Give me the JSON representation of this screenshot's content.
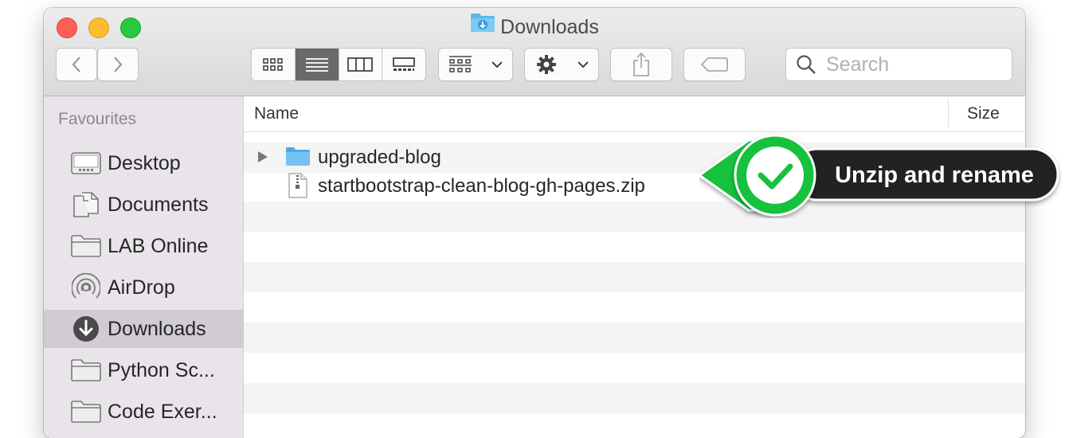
{
  "window": {
    "title": "Downloads"
  },
  "toolbar": {
    "search_placeholder": "Search"
  },
  "sidebar": {
    "heading": "Favourites",
    "items": [
      {
        "label": "Desktop",
        "icon": "desktop-icon"
      },
      {
        "label": "Documents",
        "icon": "documents-icon"
      },
      {
        "label": "LAB Online",
        "icon": "folder-icon"
      },
      {
        "label": "AirDrop",
        "icon": "airdrop-icon"
      },
      {
        "label": "Downloads",
        "icon": "downloads-icon",
        "selected": true
      },
      {
        "label": "Python Sc...",
        "icon": "folder-icon"
      },
      {
        "label": "Code Exer...",
        "icon": "folder-icon"
      }
    ]
  },
  "columns": {
    "name": "Name",
    "size": "Size"
  },
  "files": [
    {
      "name": "upgraded-blog",
      "kind": "folder",
      "expandable": true
    },
    {
      "name": "startbootstrap-clean-blog-gh-pages.zip",
      "kind": "zip"
    }
  ],
  "callout": {
    "text": "Unzip and rename",
    "accent": "#16c13d",
    "bg": "#222222"
  }
}
